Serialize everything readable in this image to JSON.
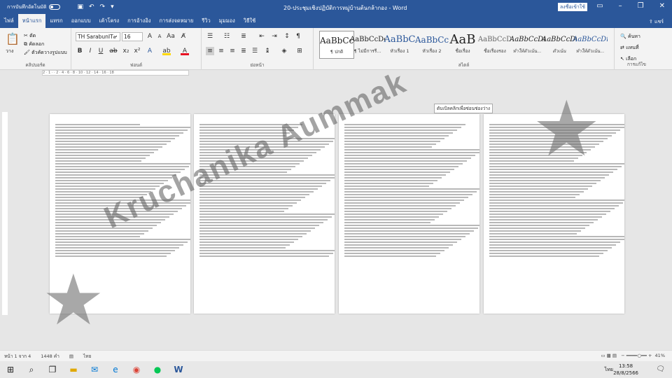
{
  "titlebar": {
    "autosave_label": "การบันทึกอัตโนมัติ",
    "document_title": "20-ประชุมเชิงปฏิบัติการหมู่บ้านต้นกล้ากอง - Word",
    "sign_in": "ลงชื่อเข้าใช้"
  },
  "tabs": [
    "ไฟล์",
    "หน้าแรก",
    "แทรก",
    "ออกแบบ",
    "เค้าโครง",
    "การอ้างอิง",
    "การส่งจดหมาย",
    "รีวิว",
    "มุมมอง",
    "วิธีใช้"
  ],
  "share": "แชร์",
  "ribbon": {
    "paste_label": "วาง",
    "cut": "ตัด",
    "copy": "คัดลอก",
    "format_painter": "ตัวคัดวางรูปแบบ",
    "clipboard_group": "คลิปบอร์ด",
    "font_name": "TH SarabunIT๙",
    "font_size": "16",
    "font_group": "ฟอนต์",
    "paragraph_group": "ย่อหน้า",
    "styles_group": "สไตล์",
    "editing_group": "การแก้ไข",
    "styles": [
      {
        "sample": "AaBbCcI",
        "name": "¶ ปกติ"
      },
      {
        "sample": "AaBbCcDd",
        "name": "¶ ไม่มีการรี..."
      },
      {
        "sample": "AaBbC",
        "name": "หัวเรื่อง 1"
      },
      {
        "sample": "AaBbCc",
        "name": "หัวเรื่อง 2"
      },
      {
        "sample": "AaB",
        "name": "ชื่อเรื่อง"
      },
      {
        "sample": "AaBbCcD",
        "name": "ชื่อเรื่องรอง"
      },
      {
        "sample": "AaBbCcDi",
        "name": "ทำให้ตัวเน้น..."
      },
      {
        "sample": "AaBbCcDi",
        "name": "ตัวเน้น"
      },
      {
        "sample": "AaBbCcDi",
        "name": "ทำให้ตัวเน้น..."
      }
    ],
    "find": "ค้นหา",
    "replace": "แทนที่",
    "select": "เลือก"
  },
  "ruler_ticks": "2 · 1 · · 2 · 4 · 6 · 8 · 10 · 12 · 14 · 16 · 18",
  "tooltip": "ดับเบิลคลิกเพื่อซ่อนช่องว่าง",
  "status": {
    "page": "หน้า 1 จาก 4",
    "words": "1448 คำ",
    "lang": "ไทย",
    "zoom": "41%"
  },
  "taskbar": {
    "time": "13:58",
    "date": "28/8/2566",
    "lang": "ไทย"
  },
  "watermark": "Kruchanika Aummak"
}
